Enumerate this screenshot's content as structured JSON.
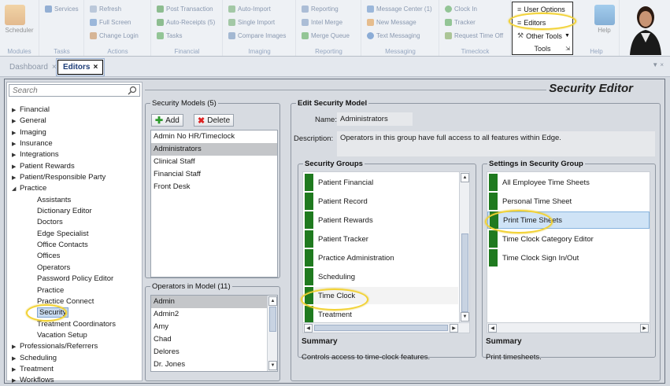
{
  "ribbon": {
    "groups": [
      {
        "title": "Modules",
        "items": [
          "Scheduler"
        ]
      },
      {
        "title": "Tasks",
        "items": [
          "Services"
        ]
      },
      {
        "title": "Actions",
        "items": [
          "Refresh",
          "Full Screen",
          "Change Login"
        ]
      },
      {
        "title": "Financial",
        "items": [
          "Post Transaction",
          "Auto-Receipts (5)",
          "Tasks"
        ]
      },
      {
        "title": "Imaging",
        "items": [
          "Auto-Import",
          "Single Import",
          "Compare Images"
        ]
      },
      {
        "title": "Reporting",
        "items": [
          "Reporting",
          "Intel Merge",
          "Merge Queue"
        ]
      },
      {
        "title": "Messaging",
        "items": [
          "Message Center (1)",
          "New Message",
          "Text Messaging"
        ]
      },
      {
        "title": "Timeclock",
        "items": [
          "Clock In",
          "Tracker",
          "Request Time Off"
        ]
      }
    ],
    "tools": {
      "title": "Tools",
      "user_options": "User Options",
      "editors": "Editors",
      "other_tools": "Other Tools"
    },
    "help": {
      "title": "Help",
      "label": "Help"
    }
  },
  "tabs": {
    "dashboard": "Dashboard",
    "editors": "Editors"
  },
  "page_title": "Security Editor",
  "search": {
    "placeholder": "Search"
  },
  "tree": [
    {
      "label": "Financial",
      "expanded": false
    },
    {
      "label": "General",
      "expanded": false
    },
    {
      "label": "Imaging",
      "expanded": false
    },
    {
      "label": "Insurance",
      "expanded": false
    },
    {
      "label": "Integrations",
      "expanded": false
    },
    {
      "label": "Patient Rewards",
      "expanded": false
    },
    {
      "label": "Patient/Responsible Party",
      "expanded": false
    },
    {
      "label": "Practice",
      "expanded": true
    },
    {
      "label": "Assistants",
      "child": true
    },
    {
      "label": "Dictionary Editor",
      "child": true
    },
    {
      "label": "Doctors",
      "child": true
    },
    {
      "label": "Edge Specialist",
      "child": true
    },
    {
      "label": "Office Contacts",
      "child": true
    },
    {
      "label": "Offices",
      "child": true
    },
    {
      "label": "Operators",
      "child": true
    },
    {
      "label": "Password Policy Editor",
      "child": true
    },
    {
      "label": "Practice",
      "child": true
    },
    {
      "label": "Practice Connect",
      "child": true
    },
    {
      "label": "Security",
      "child": true,
      "selected": true
    },
    {
      "label": "Treatment Coordinators",
      "child": true
    },
    {
      "label": "Vacation Setup",
      "child": true
    },
    {
      "label": "Professionals/Referrers",
      "expanded": false
    },
    {
      "label": "Scheduling",
      "expanded": false
    },
    {
      "label": "Treatment",
      "expanded": false
    },
    {
      "label": "Workflows",
      "expanded": false
    }
  ],
  "security_models": {
    "legend": "Security Models (5)",
    "add_label": "Add",
    "delete_label": "Delete",
    "items": [
      "Admin No HR/Timeclock",
      "Administrators",
      "Clinical Staff",
      "Financial Staff",
      "Front Desk"
    ],
    "selected": "Administrators"
  },
  "operators": {
    "legend": "Operators in Model (11)",
    "items": [
      "Admin",
      "Admin2",
      "Amy",
      "Chad",
      "Delores",
      "Dr. Jones"
    ],
    "selected": "Admin"
  },
  "edit_model": {
    "legend": "Edit Security Model",
    "name_label": "Name:",
    "name_value": "Administrators",
    "description_label": "Description:",
    "description_value": "Operators in this group have full access to all features within Edge."
  },
  "security_groups": {
    "legend": "Security Groups",
    "items": [
      "Patient Financial",
      "Patient Record",
      "Patient Rewards",
      "Patient Tracker",
      "Practice Administration",
      "Scheduling",
      "Time Clock",
      "Treatment"
    ],
    "selected": "Time Clock",
    "summary_title": "Summary",
    "summary_text": "Controls access to time-clock features."
  },
  "settings": {
    "legend": "Settings in Security Group",
    "items": [
      "All Employee Time Sheets",
      "Personal Time Sheet",
      "Print Time Sheets",
      "Time Clock Category Editor",
      "Time Clock Sign In/Out"
    ],
    "selected": "Print Time Sheets",
    "summary_title": "Summary",
    "summary_text": "Print timesheets."
  },
  "colors": {
    "enabled_bar": "#1f7a1f",
    "highlight": "#f2d234",
    "selection": "#cfe3f6"
  }
}
